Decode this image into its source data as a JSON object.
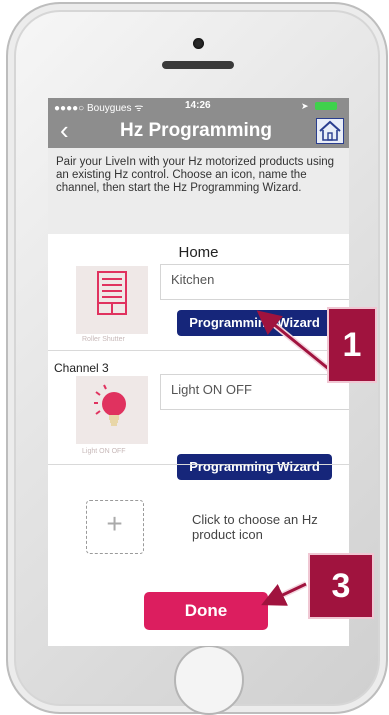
{
  "status_bar": {
    "carrier": "●●●●○ Bouygues ᯤ",
    "time": "14:26"
  },
  "nav": {
    "back_glyph": "‹",
    "title": "Hz Programming"
  },
  "intro_text": "Pair your LiveIn with your Hz motorized products using an existing Hz control. Choose an icon, name the channel, then start the Hz Programming Wizard.",
  "section_title": "Home",
  "channels": [
    {
      "channel_label": "",
      "icon": "roller-shutter-icon",
      "icon_caption": "Roller Shutter",
      "name_value": "Kitchen",
      "button_label": "Programming Wizard"
    },
    {
      "channel_label": "Channel 3",
      "icon": "light-bulb-icon",
      "icon_caption": "Light ON OFF",
      "name_value": "Light ON OFF",
      "button_label": "Programming Wizard"
    }
  ],
  "add_product": {
    "plus": "+",
    "text": "Click to choose an Hz product icon"
  },
  "done_label": "Done",
  "annotations": {
    "marker_1": "1",
    "marker_3": "3"
  },
  "colors": {
    "nav_gray": "#8d8d8d",
    "button_navy": "#16267a",
    "done_pink": "#dc1e5f",
    "marker_red": "#a0133e"
  }
}
